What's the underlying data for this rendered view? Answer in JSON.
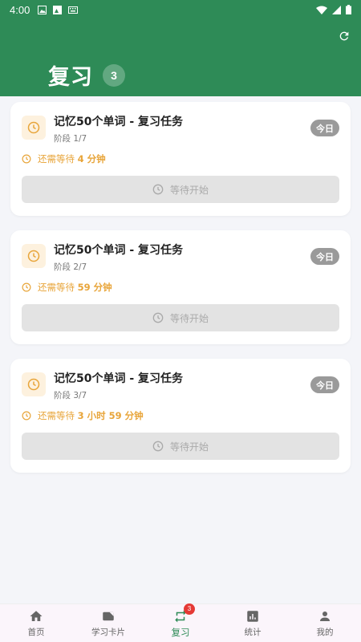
{
  "status_bar": {
    "time": "4:00",
    "icons": [
      "image-icon",
      "photo-icon",
      "keyboard-icon"
    ],
    "right_icons": [
      "wifi-icon",
      "signal-icon",
      "battery-icon"
    ]
  },
  "header": {
    "title": "复习",
    "count": "3",
    "refresh_icon": "refresh-icon",
    "bg_color": "#2e8b57"
  },
  "cards": [
    {
      "title": "记忆50个单词 - 复习任务",
      "stage": "阶段 1/7",
      "day_badge": "今日",
      "wait_prefix": "还需等待 ",
      "wait_value": "4 分钟",
      "button_label": "等待开始"
    },
    {
      "title": "记忆50个单词 - 复习任务",
      "stage": "阶段 2/7",
      "day_badge": "今日",
      "wait_prefix": "还需等待 ",
      "wait_value": "59 分钟",
      "button_label": "等待开始"
    },
    {
      "title": "记忆50个单词 - 复习任务",
      "stage": "阶段 3/7",
      "day_badge": "今日",
      "wait_prefix": "还需等待 ",
      "wait_value": "3 小时 59 分钟",
      "button_label": "等待开始"
    }
  ],
  "bottom_nav": {
    "items": [
      {
        "label": "首页",
        "icon": "home-icon"
      },
      {
        "label": "学习卡片",
        "icon": "cards-icon"
      },
      {
        "label": "复习",
        "icon": "review-icon",
        "badge": "3",
        "active": true
      },
      {
        "label": "统计",
        "icon": "stats-icon"
      },
      {
        "label": "我的",
        "icon": "profile-icon"
      }
    ]
  },
  "colors": {
    "accent": "#2e8b57",
    "warning": "#e8a53a",
    "badge": "#e53935"
  }
}
